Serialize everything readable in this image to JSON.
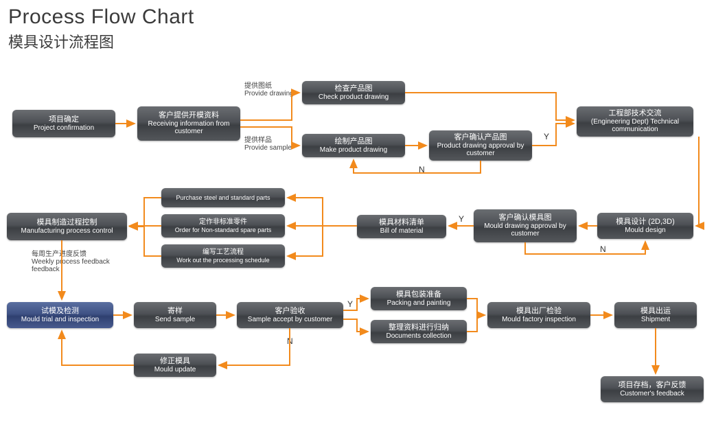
{
  "title": {
    "en": "Process Flow Chart",
    "cn": "模具设计流程图"
  },
  "labels": {
    "provideDrawing": {
      "cn": "提供图纸",
      "en": "Provide drawing"
    },
    "provideSample": {
      "cn": "提供样品",
      "en": "Provide sample"
    },
    "weeklyFeedback": {
      "cn": "每周生产进度反馈",
      "en": "Weekly process feedback"
    }
  },
  "yn": {
    "y": "Y",
    "n": "N"
  },
  "nodes": {
    "proj": {
      "cn": "项目确定",
      "en": "Project confirmation"
    },
    "recv": {
      "cn": "客户提供开模资料",
      "en": "Receiving information from customer"
    },
    "check": {
      "cn": "检查产品图",
      "en": "Check product drawing"
    },
    "make": {
      "cn": "绘制产品图",
      "en": "Make product drawing"
    },
    "prodApp": {
      "cn": "客户确认产品图",
      "en": "Product drawing approval by customer"
    },
    "tech": {
      "cn": "工程部技术交流",
      "en": "(Engineering Dept) Technical communication"
    },
    "mdesign": {
      "cn": "模具设计 (2D,3D)",
      "en": "Mould design"
    },
    "mouldApp": {
      "cn": "客户确认模具图",
      "en": "Mould drawing approval by customer"
    },
    "bom": {
      "cn": "模具材料清单",
      "en": "Bill of material"
    },
    "steel": {
      "cn": "",
      "en": "Purchase steel and standard parts"
    },
    "order": {
      "cn": "定作非标准零件",
      "en": "Order for Non-standard spare parts"
    },
    "sched": {
      "cn": "编写工艺流程",
      "en": "Work out the processing schedule"
    },
    "mpc": {
      "cn": "模具制造过程控制",
      "en": "Manufacturing process control"
    },
    "trial": {
      "cn": "试模及检测",
      "en": "Mould trial and inspection"
    },
    "send": {
      "cn": "寄样",
      "en": "Send sample"
    },
    "accept": {
      "cn": "客户验收",
      "en": "Sample accept by customer"
    },
    "update": {
      "cn": "修正模具",
      "en": "Mould update"
    },
    "pack": {
      "cn": "模具包装准备",
      "en": "Packing and painting"
    },
    "docs": {
      "cn": "整理资料进行归纳",
      "en": "Documents collection"
    },
    "insp": {
      "cn": "模具出厂检验",
      "en": "Mould factory inspection"
    },
    "ship": {
      "cn": "模具出运",
      "en": "Shipment"
    },
    "cust": {
      "cn": "项目存档，客户反馈",
      "en": "Customer's feedback"
    }
  }
}
